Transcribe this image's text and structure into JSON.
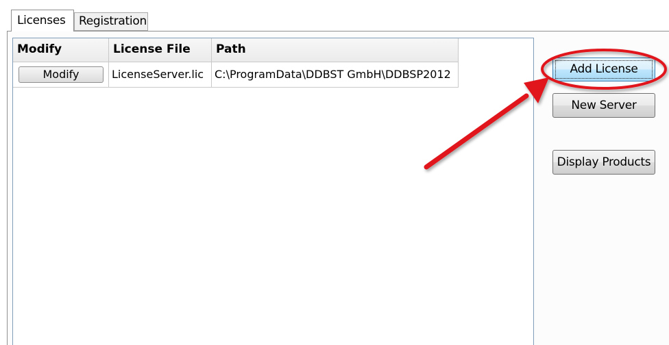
{
  "tabs": [
    {
      "label": "Licenses",
      "active": true
    },
    {
      "label": "Registration",
      "active": false
    }
  ],
  "grid": {
    "columns": [
      "Modify",
      "License File",
      "Path"
    ],
    "rows": [
      {
        "modify_button": "Modify",
        "license_file": "LicenseServer.lic",
        "path": "C:\\ProgramData\\DDBST GmbH\\DDBSP2012"
      }
    ]
  },
  "buttons": {
    "add_license": "Add License",
    "new_server": "New Server",
    "display_products": "Display Products"
  },
  "annotation": {
    "color": "#e0161e",
    "highlight": "add_license",
    "arrow_icon": "red-arrow",
    "ellipse_icon": "red-ellipse"
  }
}
